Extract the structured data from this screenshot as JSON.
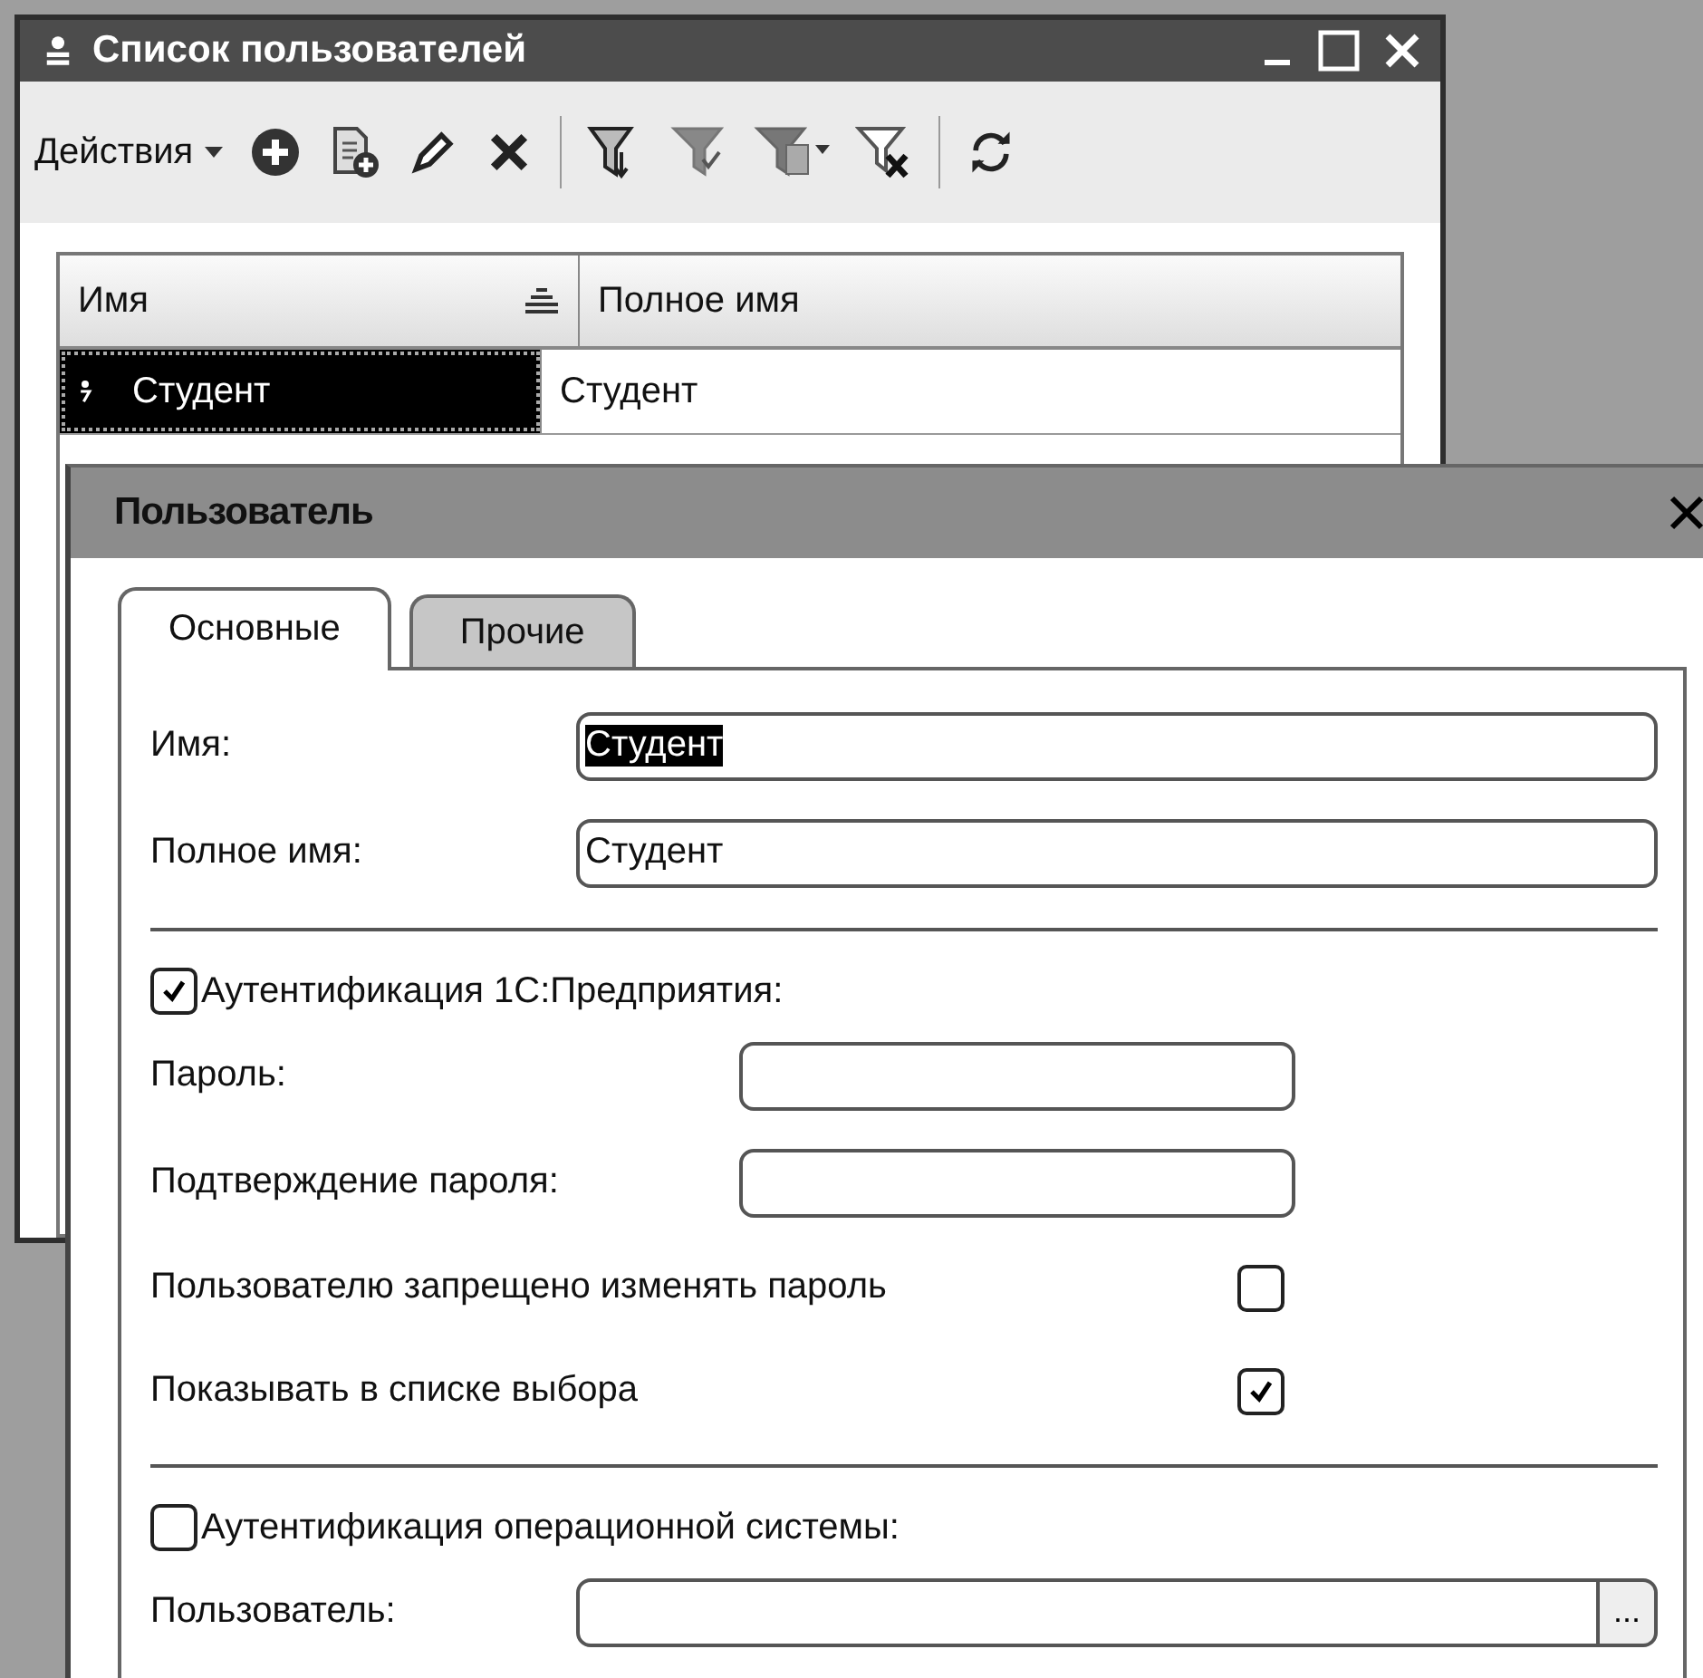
{
  "list_window": {
    "title": "Список пользователей",
    "actions_menu": "Действия",
    "table": {
      "columns": [
        "Имя",
        "Полное имя"
      ],
      "rows": [
        {
          "cells": [
            "Студент",
            "Студент"
          ],
          "selected": true
        }
      ]
    }
  },
  "dialog": {
    "title": "Пользователь",
    "tabs": [
      {
        "label": "Основные",
        "selected": true
      },
      {
        "label": "Прочие",
        "selected": false
      }
    ],
    "sections": [
      {
        "kind": "fields",
        "items": [
          {
            "kind": "field",
            "label": "Имя:",
            "value": "Студент",
            "text_selected": true
          },
          {
            "kind": "field",
            "label": "Полное имя:",
            "value": "Студент",
            "text_selected": false
          }
        ]
      },
      {
        "kind": "auth",
        "label": "Аутентификация 1С:Предприятия:",
        "checked": true,
        "items": [
          {
            "kind": "password",
            "label": "Пароль:"
          },
          {
            "kind": "password",
            "label": "Подтверждение пароля:"
          },
          {
            "kind": "option",
            "label": "Пользователю запрещено изменять пароль",
            "checked": false
          },
          {
            "kind": "option",
            "label": "Показывать в списке выбора",
            "checked": true
          }
        ]
      },
      {
        "kind": "auth",
        "label": "Аутентификация операционной системы:",
        "checked": false,
        "items": [
          {
            "kind": "chooser",
            "label": "Пользователь:",
            "button": "..."
          }
        ]
      }
    ]
  }
}
